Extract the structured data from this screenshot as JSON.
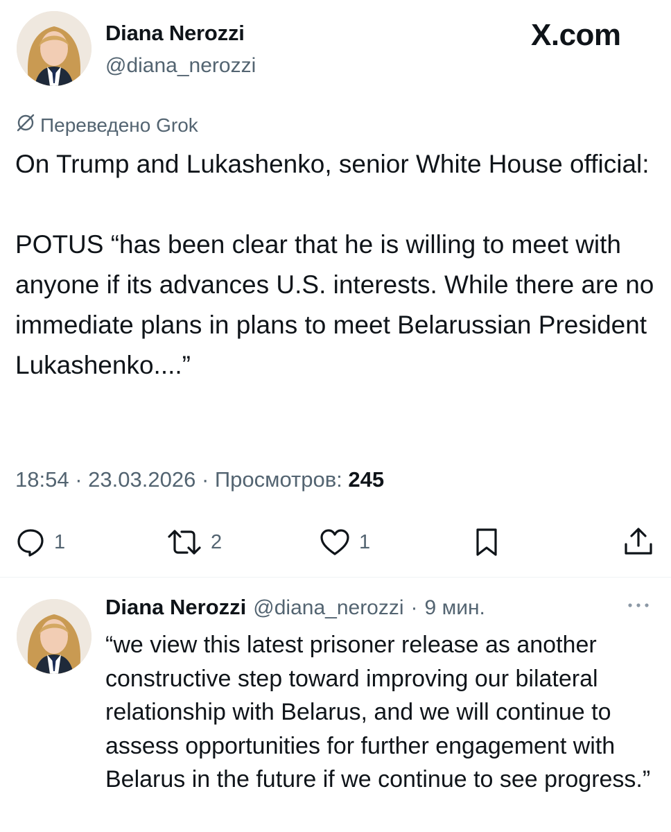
{
  "brand": {
    "text": "X.com"
  },
  "post": {
    "author_name": "Diana Nerozzi",
    "author_handle": "@diana_nerozzi",
    "translated_label": "Переведено Grok",
    "paragraphs": [
      "On Trump and Lukashenko, senior White House official:",
      "POTUS “has been clear that he is willing to meet with anyone if its advances U.S. interests. While there are no immediate plans in plans to meet Belarussian President Lukashenko....”"
    ],
    "time": "18:54",
    "date": "23.03.2026",
    "views_label": "Просмотров:",
    "views_count": "245",
    "separator": "·",
    "actions": {
      "reply_count": "1",
      "repost_count": "2",
      "like_count": "1"
    },
    "icons": {
      "reply": "reply-icon",
      "repost": "repost-icon",
      "like": "heart-icon",
      "bookmark": "bookmark-icon",
      "share": "share-icon",
      "translate": "translate-icon",
      "more": "more-icon"
    }
  },
  "reply": {
    "author_name": "Diana Nerozzi",
    "author_handle": "@diana_nerozzi",
    "separator": "·",
    "time_ago": "9 мин.",
    "text": "“we view this latest prisoner release as another constructive step toward improving our bilateral relationship with Belarus, and we will continue to assess opportunities for further engagement with Belarus in the future if we continue to see progress.”"
  },
  "colors": {
    "text_primary": "#0f1419",
    "text_secondary": "#536471",
    "divider": "#eff3f4"
  }
}
